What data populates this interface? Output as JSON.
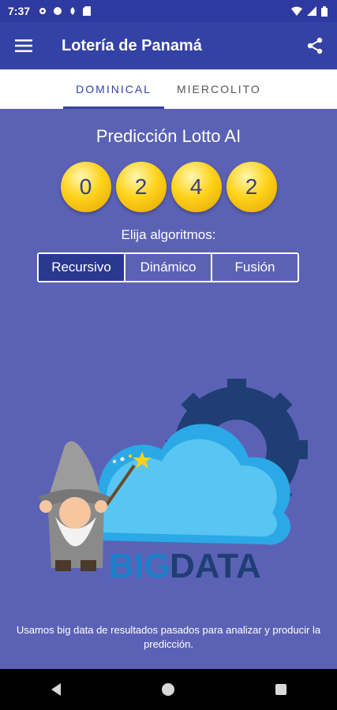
{
  "status": {
    "time": "7:37"
  },
  "appbar": {
    "title": "Lotería de Panamá"
  },
  "tabs": [
    {
      "label": "DOMINICAL",
      "active": true
    },
    {
      "label": "MIERCOLITO",
      "active": false
    }
  ],
  "prediction": {
    "title": "Predicción Lotto AI",
    "numbers": [
      "0",
      "2",
      "4",
      "2"
    ]
  },
  "algorithm": {
    "label": "Elija algoritmos:",
    "options": [
      "Recursivo",
      "Dinámico",
      "Fusión"
    ],
    "selected": "Recursivo"
  },
  "illustration": {
    "text_big": "BIG",
    "text_data": "DATA"
  },
  "footer": {
    "text": "Usamos big data de resultados pasados para analizar y producir la predicción."
  },
  "colors": {
    "background": "#5b62b5",
    "appbar": "#3442a6",
    "ball": "#ffd21a"
  }
}
